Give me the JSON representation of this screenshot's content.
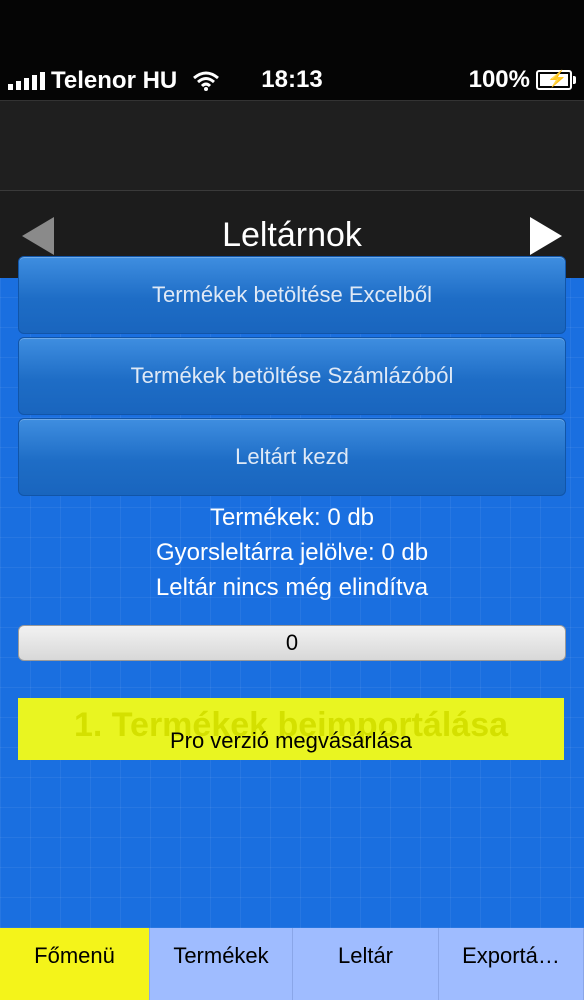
{
  "status_bar": {
    "carrier": "Telenor HU",
    "time": "18:13",
    "battery": "100%",
    "battery_level": 1.0
  },
  "nav": {
    "title": "Leltárnok",
    "back_icon": "left-arrow-icon",
    "forward_icon": "right-arrow-icon"
  },
  "menu": {
    "excel_button": "Termékek betöltése Excelből",
    "szamlazo_button": "Termékek betöltése Számlázóból",
    "start_button": "Leltárt kezd"
  },
  "info": {
    "products": "Termékek: 0 db",
    "quick_inventory": "Gyorsleltárra jelölve: 0 db",
    "inventory_status": "Leltár nincs még elindítva"
  },
  "progress": {
    "value_text": "0",
    "fraction": 0
  },
  "pro": {
    "background_text": "1. Termékek beimportálása",
    "label": "Pro verzió megvásárlása"
  },
  "tabs": [
    {
      "label": "Főmenü",
      "active": true
    },
    {
      "label": "Termékek",
      "active": false
    },
    {
      "label": "Leltár",
      "active": false
    },
    {
      "label": "Exportá…",
      "active": false
    }
  ],
  "colors": {
    "content_blue": "#1a6fe0",
    "pro_yellow": "#e9f521",
    "tab_active": "#f4f41a",
    "tab_inactive": "#9fbcff"
  }
}
